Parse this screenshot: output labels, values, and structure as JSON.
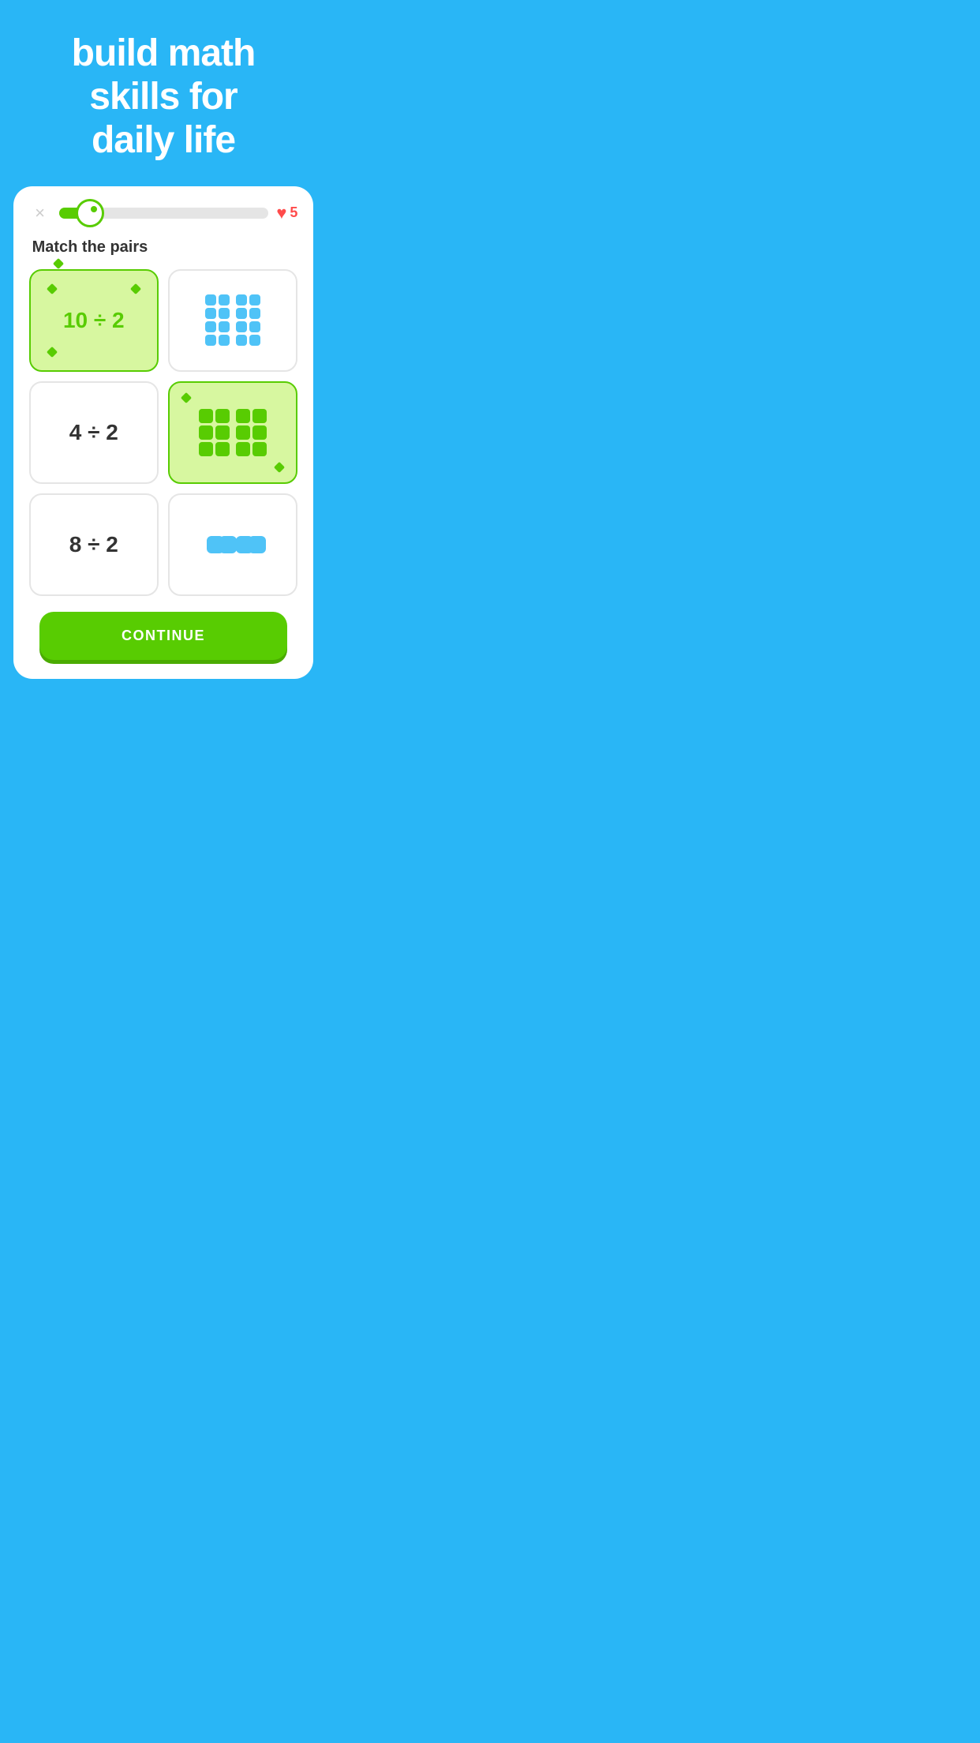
{
  "header": {
    "title": "build math\nskills for\ndaily life",
    "background_color": "#29B6F6"
  },
  "card": {
    "close_label": "×",
    "progress": {
      "value": 15,
      "max": 100,
      "percent": 15
    },
    "lives": {
      "count": "5",
      "icon": "heart"
    },
    "instruction": "Match the pairs"
  },
  "tiles": [
    {
      "id": "tile-1",
      "type": "text",
      "content": "10 ÷ 2",
      "selected": true
    },
    {
      "id": "tile-2",
      "type": "blocks",
      "pattern": "4x2+4x2",
      "selected": false
    },
    {
      "id": "tile-3",
      "type": "text",
      "content": "4 ÷ 2",
      "selected": false
    },
    {
      "id": "tile-4",
      "type": "blocks",
      "pattern": "3x2+3x2_large",
      "selected": true
    },
    {
      "id": "tile-5",
      "type": "text",
      "content": "8 ÷ 2",
      "selected": false
    },
    {
      "id": "tile-6",
      "type": "blocks",
      "pattern": "2x1+2x1",
      "selected": false
    }
  ],
  "continue_button": {
    "label": "CONTINUE"
  }
}
